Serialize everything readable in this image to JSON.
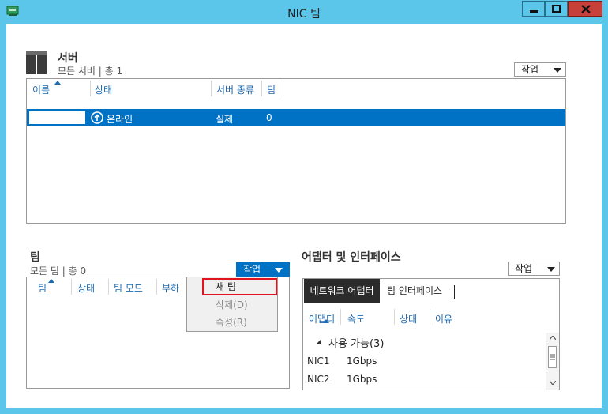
{
  "window": {
    "title": "NIC 팀"
  },
  "servers": {
    "heading": "서버",
    "subtitle": "모든 서버 | 총 1",
    "task_label": "작업",
    "columns": [
      "이름",
      "상태",
      "서버 종류",
      "팀"
    ],
    "row": {
      "name": "",
      "status": "온라인",
      "type": "실제",
      "teams": "0"
    }
  },
  "teams": {
    "heading": "팀",
    "subtitle": "모든 팀 | 총 0",
    "task_label": "작업",
    "columns": [
      "팀",
      "상태",
      "팀 모드",
      "부하"
    ],
    "menu": {
      "new_team": "새 팀",
      "delete": "삭제(D)",
      "properties": "속성(R)"
    }
  },
  "adapters": {
    "heading": "어댑터 및 인터페이스",
    "task_label": "작업",
    "tabs": [
      "네트워크 어댑터",
      "팀 인터페이스"
    ],
    "columns": [
      "어댑터",
      "속도",
      "상태",
      "이유"
    ],
    "group_label": "사용 가능(3)",
    "rows": [
      {
        "name": "NIC1",
        "speed": "1Gbps"
      },
      {
        "name": "NIC2",
        "speed": "1Gbps"
      }
    ]
  },
  "colors": {
    "accent": "#0072c6",
    "frame": "#5bc6ea",
    "highlight_box": "#e0141e"
  }
}
